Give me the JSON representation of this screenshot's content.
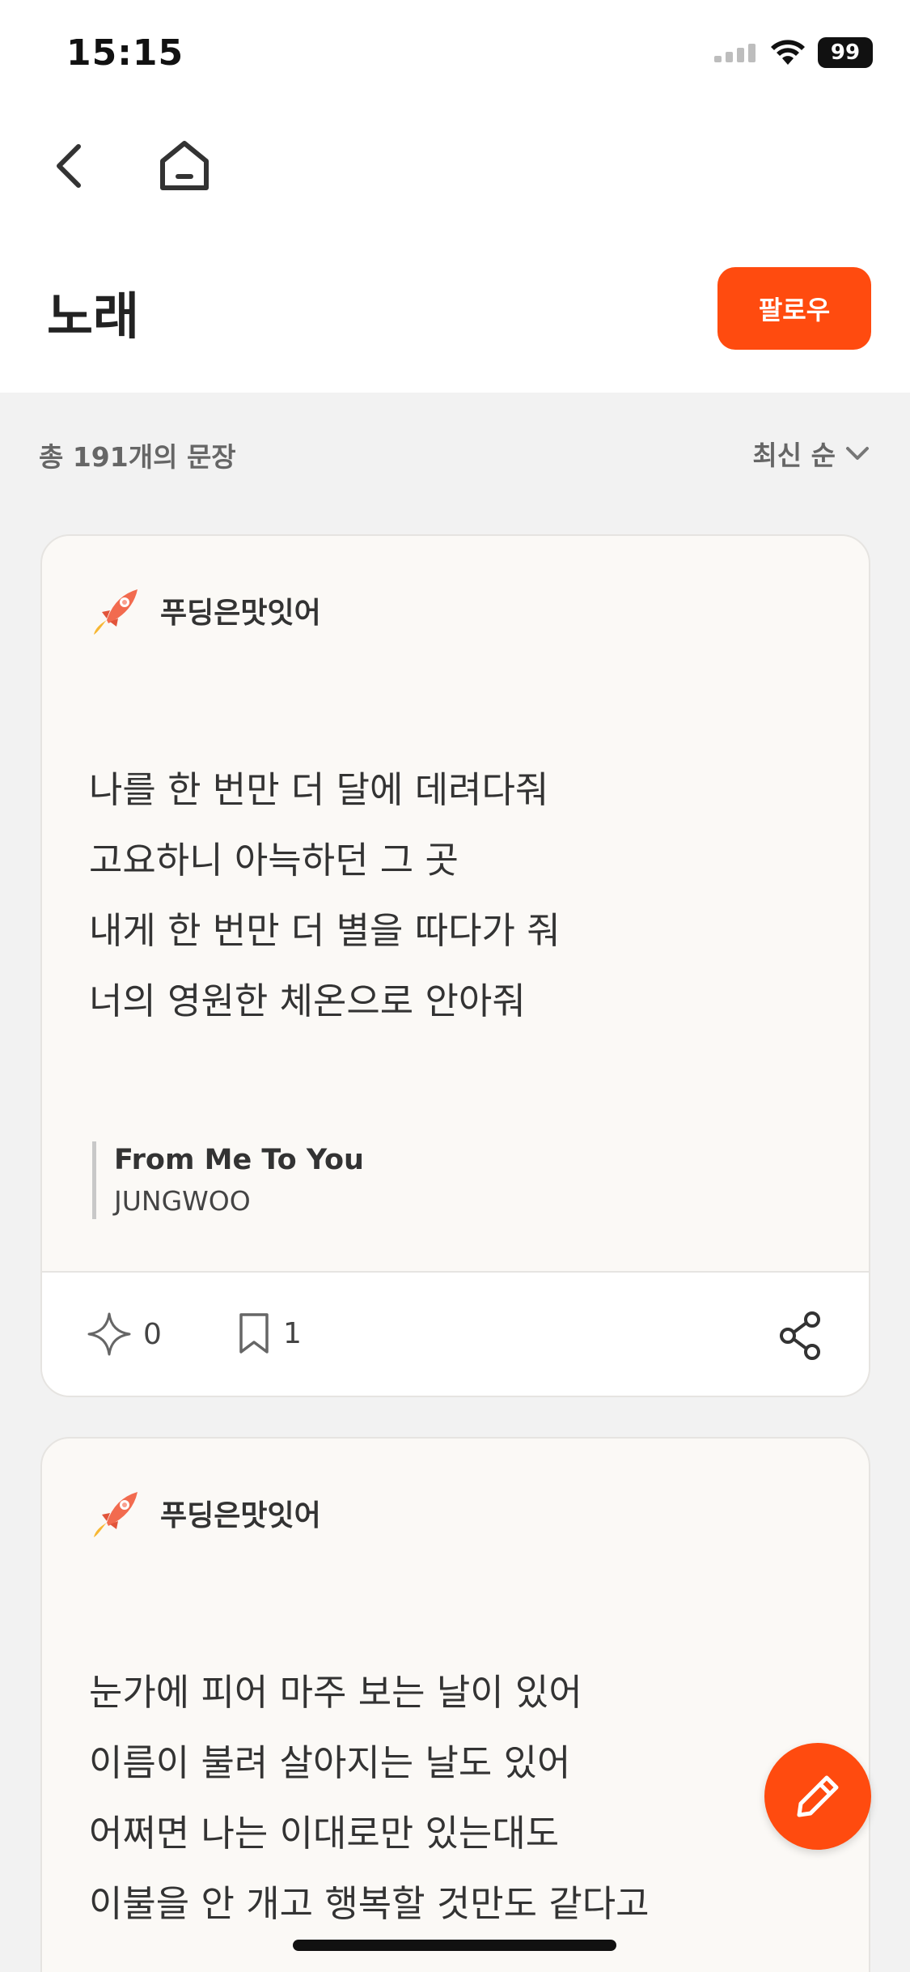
{
  "status_bar": {
    "time": "15:15",
    "battery": "99"
  },
  "header": {
    "title": "노래",
    "follow_label": "팔로우"
  },
  "list": {
    "count_text": "총 191개의 문장",
    "sort_label": "최신 순"
  },
  "colors": {
    "accent": "#ff4b0f",
    "card_bg": "#fbf9f6",
    "page_bg": "#f2f2f2"
  },
  "cards": [
    {
      "author": "푸딩은맛잇어",
      "lines": [
        "나를 한 번만 더 달에 데려다줘",
        "고요하니 아늑하던 그 곳",
        "내게 한 번만 더 별을 따다가 줘",
        "너의 영원한 체온으로 안아줘"
      ],
      "source_title": "From Me To You",
      "source_artist": "JUNGWOO",
      "likes": "0",
      "bookmarks": "1"
    },
    {
      "author": "푸딩은맛잇어",
      "lines": [
        "눈가에 피어 마주 보는 날이 있어",
        "이름이 불려 살아지는 날도 있어",
        "어쩌면 나는 이대로만 있는대도",
        "이불을 안 개고 행복할 것만도 같다고"
      ]
    }
  ],
  "icons": {
    "back": "chevron-left-icon",
    "home": "home-icon",
    "sort": "chevron-down-icon",
    "like": "sparkle-icon",
    "bookmark": "bookmark-icon",
    "share": "share-icon",
    "write": "pencil-icon",
    "avatar": "rocket-icon"
  }
}
